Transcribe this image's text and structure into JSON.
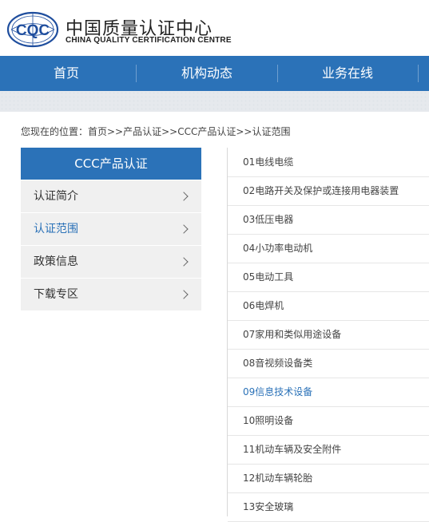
{
  "header": {
    "logo_text": "CQC",
    "title_cn": "中国质量认证中心",
    "title_en": "CHINA QUALITY CERTIFICATION CENTRE"
  },
  "nav": {
    "items": [
      "首页",
      "机构动态",
      "业务在线"
    ]
  },
  "breadcrumb": "您现在的位置：首页>>产品认证>>CCC产品认证>>认证范围",
  "sidebar": {
    "title": "CCC产品认证",
    "items": [
      {
        "label": "认证简介"
      },
      {
        "label": "认证范围"
      },
      {
        "label": "政策信息"
      },
      {
        "label": "下载专区"
      }
    ],
    "active_index": 1
  },
  "scope_list": [
    "01电线电缆",
    "02电路开关及保护或连接用电器装置",
    "03低压电器",
    "04小功率电动机",
    "05电动工具",
    "06电焊机",
    "07家用和类似用途设备",
    "08音视频设备类",
    "09信息技术设备",
    "10照明设备",
    "11机动车辆及安全附件",
    "12机动车辆轮胎",
    "13安全玻璃"
  ],
  "colors": {
    "brand_blue": "#2b72b8",
    "sidebar_bg": "#f0f0f0",
    "band_gray": "#e6e9ed"
  }
}
